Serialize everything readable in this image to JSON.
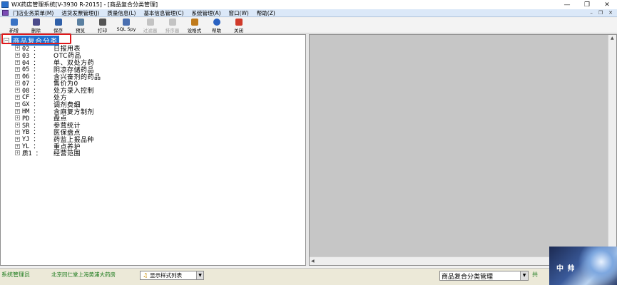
{
  "window": {
    "title": "WX药店管理系统[V-3930 R-2015] - [商品复合分类管理]",
    "controls": [
      "—",
      "❐",
      "✕"
    ]
  },
  "menubar": {
    "items": [
      "门店业务菜单(M)",
      "进货发票管理(J)",
      "质量信息(L)",
      "基本信息管理(C)",
      "系统管理(A)",
      "窗口(W)",
      "帮助(Z)"
    ],
    "mdi_controls": [
      "–",
      "❐",
      "✕"
    ]
  },
  "toolbar": {
    "buttons": [
      {
        "label": "新增",
        "icon": "new-icon",
        "color": "#3a73c4",
        "enabled": true
      },
      {
        "label": "删除",
        "icon": "delete-icon",
        "color": "#4a4a8a",
        "enabled": true
      },
      {
        "label": "保存",
        "icon": "save-icon",
        "color": "#2f5fa8",
        "enabled": true
      },
      {
        "label": "预览",
        "icon": "preview-icon",
        "color": "#5a7fa0",
        "enabled": true
      },
      {
        "label": "打印",
        "icon": "print-icon",
        "color": "#555555",
        "enabled": true
      },
      {
        "label": "SQL Spy",
        "icon": "sql-spy-icon",
        "color": "#4a6fb0",
        "enabled": true
      },
      {
        "label": "过滤器",
        "icon": "filter-icon",
        "color": "#8a8a8a",
        "enabled": false
      },
      {
        "label": "排序器",
        "icon": "sort-icon",
        "color": "#8a8a8a",
        "enabled": false
      },
      {
        "label": "设格式",
        "icon": "format-icon",
        "color": "#c07a1a",
        "enabled": true
      },
      {
        "label": "帮助",
        "icon": "help-icon",
        "color": "#2a62c2",
        "enabled": true
      },
      {
        "label": "关闭",
        "icon": "close-icon",
        "color": "#d03a2a",
        "enabled": true
      }
    ]
  },
  "tree": {
    "root": "商品复合分类",
    "nodes": [
      {
        "code": "02 ：",
        "name": "日报用表"
      },
      {
        "code": "03 ：",
        "name": "OTC药品"
      },
      {
        "code": "04 ：",
        "name": "单、双处方药"
      },
      {
        "code": "05 ：",
        "name": "阴凉存储药品"
      },
      {
        "code": "06 ：",
        "name": "含兴奋剂的药品"
      },
      {
        "code": "07 ：",
        "name": "售价为0"
      },
      {
        "code": "08 ：",
        "name": "处方录入控制"
      },
      {
        "code": "CF ：",
        "name": "处方"
      },
      {
        "code": "GX ：",
        "name": "调剂费细"
      },
      {
        "code": "HM ：",
        "name": "含麻复方制剂"
      },
      {
        "code": "PD ：",
        "name": "盘点"
      },
      {
        "code": "SR ：",
        "name": "参茸统计"
      },
      {
        "code": "YB ：",
        "name": "医保盘点"
      },
      {
        "code": "YJ ：",
        "name": "药监上报品种"
      },
      {
        "code": "YL ：",
        "name": "重点养护"
      },
      {
        "code": "质1 ：",
        "name": "经营范围"
      }
    ]
  },
  "statusbar": {
    "user": "系统管理员",
    "store": "北京同仁堂上海黄浦大药房",
    "display_style": "显示样式列表",
    "module": "商品复合分类管理",
    "count": "共",
    "banner_text": "中 帅"
  }
}
